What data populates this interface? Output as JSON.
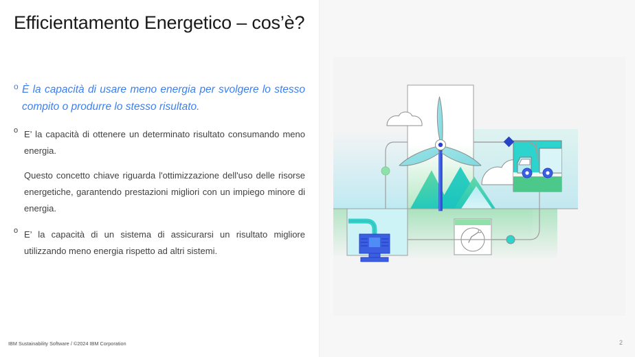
{
  "slide": {
    "title": "Efficientamento Energetico – cos’è?",
    "page_number": "2",
    "footer": "IBM Sustainability Software / ©2024 IBM Corporation"
  },
  "content": {
    "bullet_mark": "o",
    "items": [
      {
        "id": "lead",
        "style": "blue-italic",
        "mark": "o",
        "text": "È la capacità di usare meno energia per svolgere lo stesso compito o produrre lo stesso risultato."
      },
      {
        "id": "bullet-2",
        "style": "regular",
        "mark": "o",
        "text": "E’ la capacità di ottenere un determinato risultato consumando meno energia."
      },
      {
        "id": "paragraph",
        "style": "paragraph",
        "mark": "",
        "text": "Questo concetto chiave riguarda l'ottimizzazione dell'uso delle risorse energetiche, garantendo prestazioni migliori con un impiego minore di energia."
      },
      {
        "id": "bullet-3",
        "style": "regular",
        "mark": "o",
        "text": "E’ la capacità di un sistema di assicurarsi un risultato migliore utilizzando meno energia rispetto ad altri sistemi."
      }
    ]
  },
  "illustration": {
    "name": "sustainability-energy-illustration",
    "alt": "Wind turbine, mountains, clouds, delivery truck, water pump and gauge connected by lines",
    "elements": [
      "wind-turbine",
      "mountains",
      "small-cloud",
      "large-cloud",
      "delivery-truck-panel",
      "water-pump-panel",
      "gauge-card",
      "connector-lines",
      "green-dot-node",
      "blue-diamond-node",
      "teal-dot-node"
    ],
    "colors": {
      "background": "#f4f4f4",
      "teal": "#2dd4cd",
      "teal_dark": "#17c2bd",
      "green": "#4cc98a",
      "green_light": "#8fe0ab",
      "blue": "#3b5fe0",
      "blue_dark": "#2743c9",
      "cyan_light": "#cdf3f7",
      "line_gray": "#8d8d8d",
      "white": "#ffffff"
    }
  },
  "theme": {
    "accent_blue": "#3b7ff0",
    "text_dark": "#1a1a1a",
    "text_body": "#3f3f3f",
    "panel_bg": "#f7f7f7"
  }
}
